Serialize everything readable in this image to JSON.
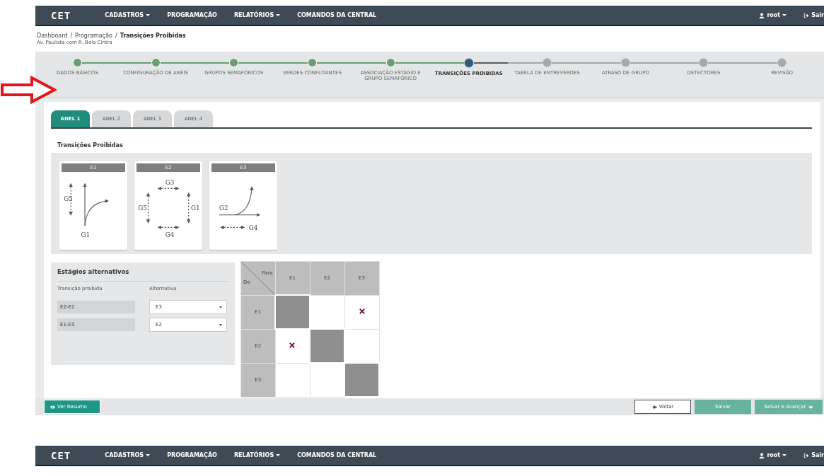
{
  "navbar": {
    "logo": "CET",
    "menu": [
      {
        "label": "CADASTROS",
        "dropdown": true
      },
      {
        "label": "PROGRAMAÇÃO",
        "dropdown": false
      },
      {
        "label": "RELATÓRIOS",
        "dropdown": true
      },
      {
        "label": "COMANDOS DA CENTRAL",
        "dropdown": false
      }
    ],
    "user": "root",
    "logout": "Sair"
  },
  "breadcrumb": {
    "items": [
      {
        "label": "Dashboard",
        "separator": "/"
      },
      {
        "label": "Programação",
        "separator": "/"
      }
    ],
    "current": "Transições Proibidas",
    "subtitle": "Av. Paulista com R. Bela Cintra"
  },
  "stepper": [
    {
      "label": "DADOS BÁSICOS",
      "completed": true,
      "selected": false
    },
    {
      "label": "CONFIGURAÇÃO DE ANÉIS",
      "completed": true,
      "selected": false
    },
    {
      "label": "GRUPOS SEMAFÓRICOS",
      "completed": true,
      "selected": false
    },
    {
      "label": "VERDES CONFLITANTES",
      "completed": true,
      "selected": false
    },
    {
      "label": "ASSOCIAÇÃO ESTÁGIO E GRUPO SEMAFÓRICO",
      "completed": true,
      "selected": false
    },
    {
      "label": "TRANSIÇÕES PROIBIDAS",
      "completed": false,
      "selected": true
    },
    {
      "label": "TABELA DE ENTREVERDES",
      "completed": false,
      "selected": false
    },
    {
      "label": "ATRASO DE GRUPO",
      "completed": false,
      "selected": false
    },
    {
      "label": "DETECTORES",
      "completed": false,
      "selected": false
    },
    {
      "label": "REVISÃO",
      "completed": false,
      "selected": false
    }
  ],
  "tabs": [
    {
      "label": "ANEL 1",
      "selected": true
    },
    {
      "label": "ANEL 2",
      "selected": false
    },
    {
      "label": "ANEL 3",
      "selected": false
    },
    {
      "label": "ANEL 4",
      "selected": false
    }
  ],
  "section_title": "Transições Proibidas",
  "stages": [
    {
      "name": "E1",
      "kind": "e1",
      "groups": [
        "G5",
        "G1"
      ]
    },
    {
      "name": "E2",
      "kind": "e2",
      "groups": [
        "G3",
        "G5",
        "G1",
        "G4"
      ]
    },
    {
      "name": "E3",
      "kind": "e3",
      "groups": [
        "G2",
        "G4"
      ]
    }
  ],
  "alternatives": {
    "title": "Estágios alternativos",
    "columns": [
      "Transição proibida",
      "Alternativa"
    ],
    "rows": [
      {
        "transition": "E2-E1",
        "alternative": "E3"
      },
      {
        "transition": "E1-E3",
        "alternative": "E2"
      }
    ]
  },
  "matrix": {
    "to_label": "Para",
    "from_label": "De",
    "columns": [
      "E1",
      "E2",
      "E3"
    ],
    "rows": [
      {
        "label": "E1",
        "cells": [
          {
            "diagonal": true,
            "forbidden": false
          },
          {
            "diagonal": false,
            "forbidden": false
          },
          {
            "diagonal": false,
            "forbidden": true
          }
        ]
      },
      {
        "label": "E2",
        "cells": [
          {
            "diagonal": false,
            "forbidden": true
          },
          {
            "diagonal": true,
            "forbidden": false
          },
          {
            "diagonal": false,
            "forbidden": false
          }
        ]
      },
      {
        "label": "E3",
        "cells": [
          {
            "diagonal": false,
            "forbidden": false
          },
          {
            "diagonal": false,
            "forbidden": false
          },
          {
            "diagonal": true,
            "forbidden": false
          }
        ]
      }
    ]
  },
  "footer": {
    "summary_button": "Ver Resumo",
    "back_button": "Voltar",
    "save_button": "Salvar",
    "save_next_button": "Salvar e Avançar"
  },
  "bottom_navbar": {
    "logo": "CET",
    "menu": [
      {
        "label": "CADASTROS",
        "dropdown": true
      },
      {
        "label": "PROGRAMAÇÃO",
        "dropdown": false
      },
      {
        "label": "RELATÓRIOS",
        "dropdown": true
      },
      {
        "label": "COMANDOS DA CENTRAL",
        "dropdown": false
      }
    ],
    "user": "root",
    "logout": "Sair"
  }
}
